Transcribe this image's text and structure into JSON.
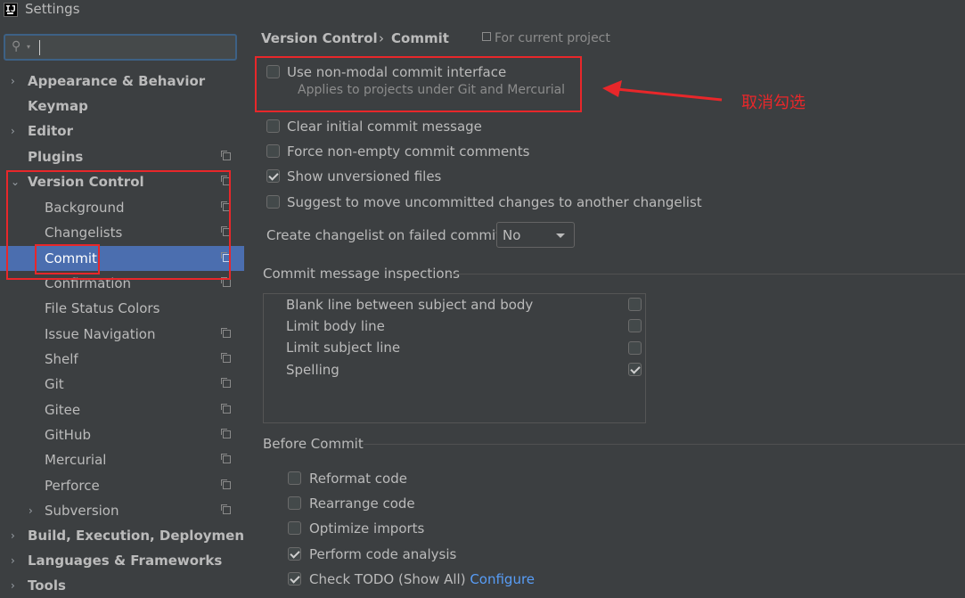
{
  "window": {
    "title": "Settings"
  },
  "search": {
    "placeholder": "",
    "value": ""
  },
  "tree": [
    {
      "label": "Appearance & Behavior",
      "arrow": "›",
      "bold": true
    },
    {
      "label": "Keymap",
      "arrow": "",
      "bold": true
    },
    {
      "label": "Editor",
      "arrow": "›",
      "bold": true
    },
    {
      "label": "Plugins",
      "arrow": "",
      "bold": true,
      "project_icon": true
    },
    {
      "label": "Version Control",
      "arrow": "⌄",
      "bold": true,
      "project_icon": true
    },
    {
      "label": "Background",
      "project_icon": true
    },
    {
      "label": "Changelists",
      "project_icon": true
    },
    {
      "label": "Commit",
      "project_icon": true,
      "selected": true
    },
    {
      "label": "Confirmation",
      "project_icon": true
    },
    {
      "label": "File Status Colors"
    },
    {
      "label": "Issue Navigation",
      "project_icon": true
    },
    {
      "label": "Shelf",
      "project_icon": true
    },
    {
      "label": "Git",
      "project_icon": true
    },
    {
      "label": "Gitee",
      "project_icon": true
    },
    {
      "label": "GitHub",
      "project_icon": true
    },
    {
      "label": "Mercurial",
      "project_icon": true
    },
    {
      "label": "Perforce",
      "project_icon": true
    },
    {
      "label": "Subversion",
      "arrow": "›",
      "project_icon": true
    },
    {
      "label": "Build, Execution, Deployment",
      "arrow": "›",
      "bold": true
    },
    {
      "label": "Languages & Frameworks",
      "arrow": "›",
      "bold": true
    },
    {
      "label": "Tools",
      "arrow": "›",
      "bold": true
    }
  ],
  "breadcrumb": {
    "parent": "Version Control",
    "separator": "›",
    "current": "Commit",
    "scope": "For current project"
  },
  "options": {
    "non_modal": {
      "label": "Use non-modal commit interface",
      "checked": false,
      "hint": "Applies to projects under Git and Mercurial"
    },
    "clear_initial": {
      "label": "Clear initial commit message",
      "checked": false
    },
    "force_nonempty": {
      "label": "Force non-empty commit comments",
      "checked": false
    },
    "show_unversioned": {
      "label": "Show unversioned files",
      "checked": true
    },
    "suggest_move": {
      "label": "Suggest to move uncommitted changes to another changelist",
      "checked": false
    }
  },
  "changelist_failed": {
    "label": "Create changelist on failed commit:",
    "value": "No"
  },
  "inspections": {
    "title": "Commit message inspections",
    "items": [
      {
        "label": "Blank line between subject and body",
        "checked": false
      },
      {
        "label": "Limit body line",
        "checked": false
      },
      {
        "label": "Limit subject line",
        "checked": false
      },
      {
        "label": "Spelling",
        "checked": true
      }
    ]
  },
  "before_commit": {
    "title": "Before Commit",
    "items": [
      {
        "label": "Reformat code",
        "checked": false
      },
      {
        "label": "Rearrange code",
        "checked": false
      },
      {
        "label": "Optimize imports",
        "checked": false
      },
      {
        "label": "Perform code analysis",
        "checked": true
      },
      {
        "label": "Check TODO (Show All)",
        "checked": true,
        "link": "Configure"
      }
    ]
  },
  "annotation": {
    "text": "取消勾选",
    "color": "#e8272a"
  },
  "colors": {
    "accent": "#4b6eaf",
    "link": "#589df6",
    "annotation": "#e8272a"
  }
}
